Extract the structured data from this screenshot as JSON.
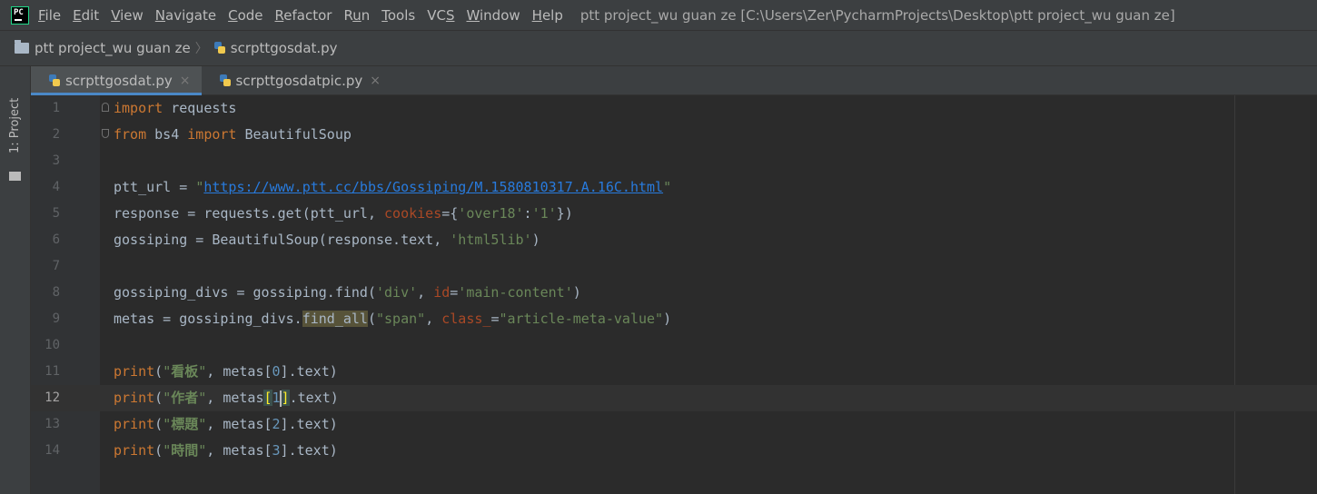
{
  "menubar": {
    "app_icon_text": "PC",
    "items": [
      "File",
      "Edit",
      "View",
      "Navigate",
      "Code",
      "Refactor",
      "Run",
      "Tools",
      "VCS",
      "Window",
      "Help"
    ],
    "window_title": "ptt project_wu guan ze [C:\\Users\\Zer\\PycharmProjects\\Desktop\\ptt project_wu guan ze]"
  },
  "navbar": {
    "project": "ptt project_wu guan ze",
    "separator": "〉",
    "file": "scrpttgosdat.py"
  },
  "toolstrip": {
    "label": "1: Project"
  },
  "tabs": [
    {
      "label": "scrpttgosdat.py",
      "close": "×"
    },
    {
      "label": "scrpttgosdatpic.py",
      "close": "×"
    }
  ],
  "editor": {
    "line_numbers": [
      "1",
      "2",
      "3",
      "4",
      "5",
      "6",
      "7",
      "8",
      "9",
      "10",
      "11",
      "12",
      "13",
      "14"
    ],
    "current_line": 12,
    "l1": {
      "kw": "import",
      "rest": " requests"
    },
    "l2": {
      "kw1": "from",
      "mid": " bs4 ",
      "kw2": "import",
      "rest": " BeautifulSoup"
    },
    "l4": {
      "pre": "ptt_url = ",
      "q1": "\"",
      "url": "https://www.ptt.cc/bbs/Gossiping/M.1580810317.A.16C.html",
      "q2": "\""
    },
    "l5": {
      "pre": "response = requests.get(ptt_url, ",
      "param": "cookies",
      "eq": "={",
      "s1": "'over18'",
      "colon": ":",
      "s2": "'1'",
      "post": "})"
    },
    "l6": {
      "pre": "gossiping = BeautifulSoup(response.text, ",
      "s": "'html5lib'",
      "post": ")"
    },
    "l8": {
      "pre": "gossiping_divs = gossiping.find(",
      "s1": "'div'",
      "mid": ", ",
      "param": "id",
      "eq": "=",
      "s2": "'main-content'",
      "post": ")"
    },
    "l9": {
      "pre": "metas = gossiping_divs.",
      "hl": "find_all",
      "open": "(",
      "s1": "\"span\"",
      "mid": ", ",
      "param": "class_",
      "eq": "=",
      "s2": "\"article-meta-value\"",
      "post": ")"
    },
    "print_lines": [
      {
        "kw": "print",
        "open": "(",
        "q1": "\"",
        "cjk": "看板",
        "q2": "\"",
        "mid": ", metas[",
        "idx": "0",
        "post": "].text)"
      },
      {
        "kw": "print",
        "open": "(",
        "q1": "\"",
        "cjk": "作者",
        "q2": "\"",
        "mid": ", metas",
        "lb": "[",
        "idx": "1",
        "rb": "]",
        "post": ".text)"
      },
      {
        "kw": "print",
        "open": "(",
        "q1": "\"",
        "cjk": "標題",
        "q2": "\"",
        "mid": ", metas[",
        "idx": "2",
        "post": "].text)"
      },
      {
        "kw": "print",
        "open": "(",
        "q1": "\"",
        "cjk": "時間",
        "q2": "\"",
        "mid": ", metas[",
        "idx": "3",
        "post": "].text)"
      }
    ]
  }
}
